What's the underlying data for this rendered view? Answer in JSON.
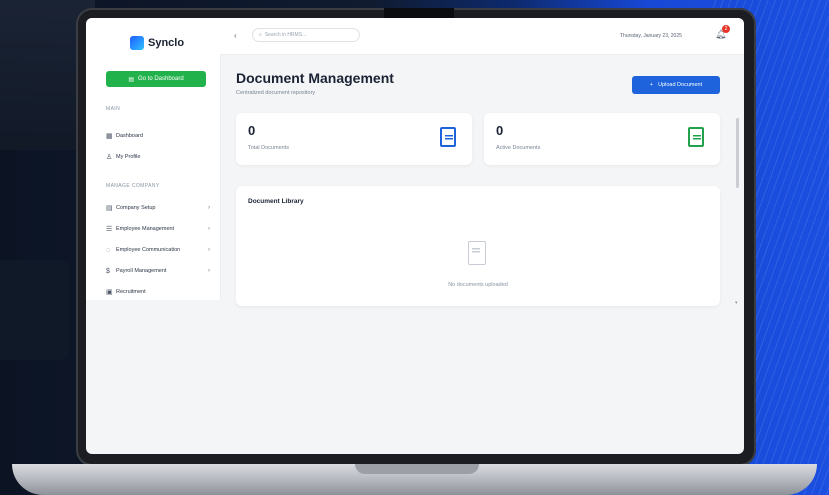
{
  "app": {
    "name": "Synclo"
  },
  "sidebar": {
    "dashboard_button": "Go to Dashboard",
    "sections": [
      {
        "label": "MAIN",
        "items": [
          {
            "label": "Dashboard",
            "icon": "grid-icon",
            "glyph": "▦"
          },
          {
            "label": "My Profile",
            "icon": "user-icon",
            "glyph": "♙"
          }
        ]
      },
      {
        "label": "MANAGE COMPANY",
        "items": [
          {
            "label": "Company Setup",
            "icon": "building-icon",
            "glyph": "▤",
            "chevron": "›"
          },
          {
            "label": "Employee Management",
            "icon": "users-icon",
            "glyph": "☰",
            "chevron": "›"
          },
          {
            "label": "Employee Communication",
            "icon": "chat-icon",
            "glyph": "◌",
            "chevron": "›"
          },
          {
            "label": "Payroll Management",
            "icon": "dollar-icon",
            "glyph": "$",
            "chevron": "›"
          },
          {
            "label": "Recruitment",
            "icon": "briefcase-icon",
            "glyph": "▣"
          }
        ]
      }
    ]
  },
  "topbar": {
    "back_glyph": "‹",
    "search_placeholder": "Search in HRMS...",
    "date": "Thursday, January 23, 2025",
    "notification_count": "2"
  },
  "page": {
    "title": "Document Management",
    "subtitle": "Centralized document repository",
    "upload_button": "Upload Document"
  },
  "stats": [
    {
      "value": "0",
      "label": "Total Documents",
      "icon": "document-icon",
      "color": "#1e63dc"
    },
    {
      "value": "0",
      "label": "Active Documents",
      "icon": "document-icon",
      "color": "#22a04a"
    }
  ],
  "library": {
    "title": "Document Library",
    "empty_text": "No documents uploaded"
  },
  "colors": {
    "accent": "#1e63dc",
    "success": "#22b24c",
    "alert": "#e5342a"
  }
}
